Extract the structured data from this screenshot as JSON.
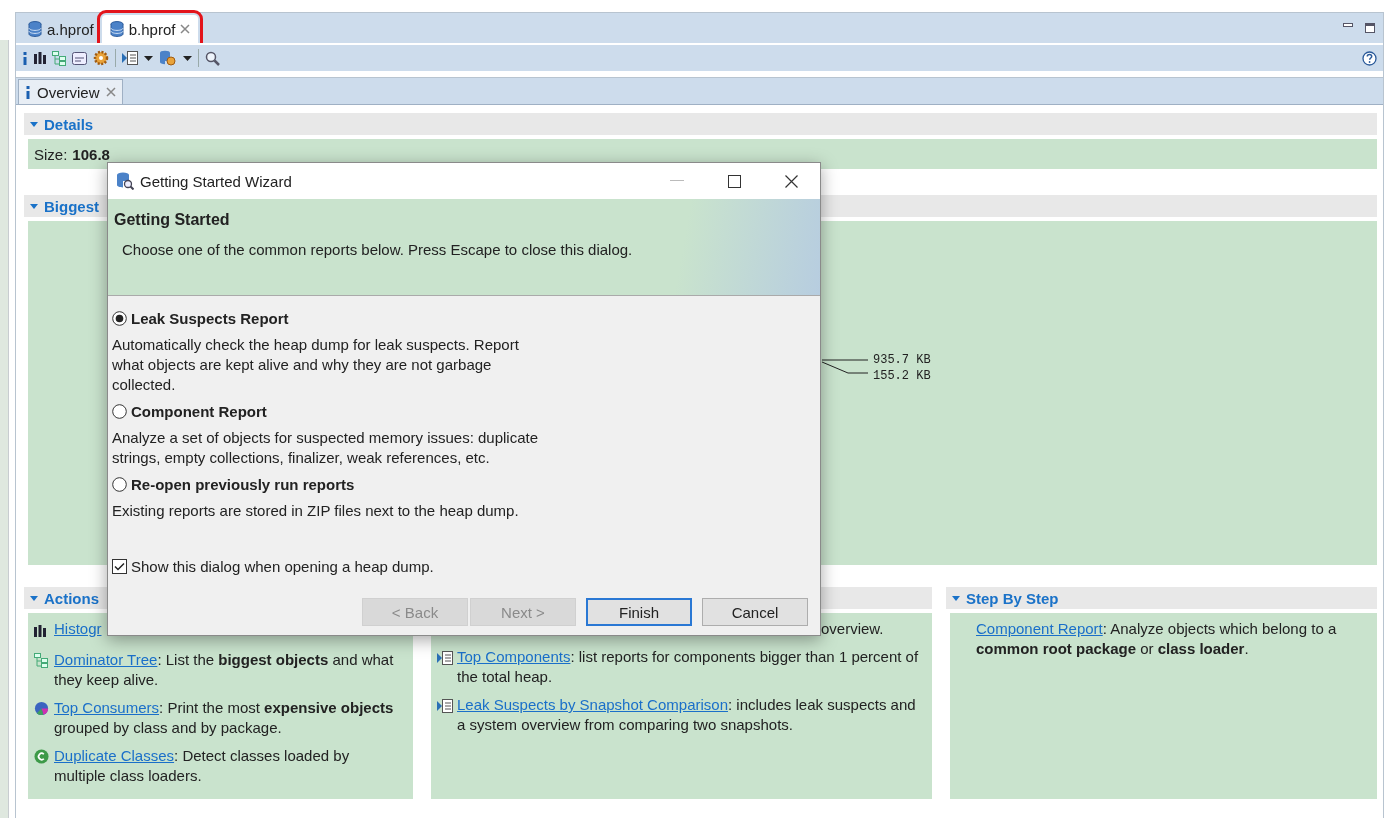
{
  "editor_tabs": [
    {
      "label": "a.hprof",
      "selected": false,
      "closable": false,
      "highlighted": false
    },
    {
      "label": "b.hprof",
      "selected": true,
      "closable": true,
      "highlighted": true
    }
  ],
  "view_tab": {
    "label": "Overview",
    "selected": true
  },
  "details": {
    "title": "Details",
    "expanded": true,
    "size_label": "Size:",
    "size_value": "106.8"
  },
  "biggest": {
    "title": "Biggest",
    "expanded": true,
    "chart_labels": [
      "935.7 KB",
      "155.2 KB"
    ]
  },
  "columns": [
    {
      "title": "Actions",
      "expanded": true,
      "items": [
        {
          "kind": "histogram",
          "link": "Histogr"
        },
        {
          "kind": "tree",
          "link": "Dominator Tree",
          "text": ": List the **biggest objects** and what they keep alive."
        },
        {
          "kind": "pie",
          "link": "Top Consumers",
          "text": ": Print the most **expensive objects** grouped by class and by package."
        },
        {
          "kind": "classes",
          "link": "Duplicate Classes",
          "text": ": Detect classes loaded by multiple class loaders."
        }
      ]
    },
    {
      "expanded": true,
      "items": [
        {
          "kind": "partial",
          "text": "overview."
        },
        {
          "kind": "report",
          "link": "Top Components",
          "text": ": list reports for components bigger than 1 percent of the total heap."
        },
        {
          "kind": "report",
          "link": "Leak Suspects by Snapshot Comparison",
          "text": ": includes leak suspects and a system overview from comparing two snapshots."
        }
      ]
    },
    {
      "title": "Step By Step",
      "expanded": true,
      "items": [
        {
          "kind": "plain",
          "link": "Component Report",
          "text": ": Analyze objects which belong to a **common root package** or **class loader**."
        }
      ]
    }
  ],
  "dialog": {
    "title": "Getting Started Wizard",
    "heading": "Getting Started",
    "subtitle": "Choose one of the common reports below. Press Escape to close this dialog.",
    "options": [
      {
        "label": "Leak Suspects Report",
        "selected": true,
        "description": "Automatically check the heap dump for leak suspects. Report what objects are kept alive and why they are not garbage collected."
      },
      {
        "label": "Component Report",
        "selected": false,
        "description": "Analyze a set of objects for suspected memory issues: duplicate strings, empty collections, finalizer, weak references, etc."
      },
      {
        "label": "Re-open previously run reports",
        "selected": false,
        "description": "Existing reports are stored in ZIP files next to the heap dump."
      }
    ],
    "show_on_open": {
      "label": "Show this dialog when opening a heap dump.",
      "checked": true
    },
    "buttons": [
      {
        "label": "< Back",
        "disabled": true,
        "default": false
      },
      {
        "label": "Next >",
        "disabled": true,
        "default": false
      },
      {
        "label": "Finish",
        "disabled": false,
        "default": true
      },
      {
        "label": "Cancel",
        "disabled": false,
        "default": false
      }
    ]
  }
}
